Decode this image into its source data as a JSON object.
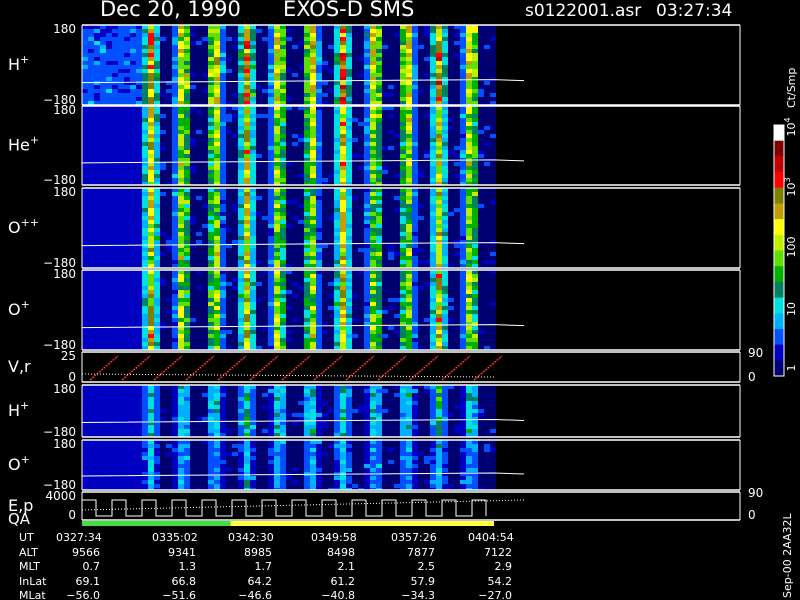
{
  "header": {
    "date": "Dec 20, 1990",
    "instrument": "EXOS-D SMS",
    "file": "s0122001.asr",
    "time": "03:27:34"
  },
  "panels": [
    {
      "label": "H",
      "sup": "+",
      "ytop": "180",
      "ybot": "−180",
      "kind": "spectrogram",
      "intensity": 1.0
    },
    {
      "label": "He",
      "sup": "+",
      "ytop": "180",
      "ybot": "−180",
      "kind": "spectrogram",
      "intensity": 0.85
    },
    {
      "label": "O",
      "sup": "++",
      "ytop": "180",
      "ybot": "−180",
      "kind": "spectrogram",
      "intensity": 0.8
    },
    {
      "label": "O",
      "sup": "+",
      "ytop": "180",
      "ybot": "−180",
      "kind": "spectrogram",
      "intensity": 0.85
    },
    {
      "label": "V,r",
      "sup": "",
      "ytop": "25",
      "ybot": "0",
      "kind": "line",
      "right_top": "90",
      "right_bot": "0"
    },
    {
      "label": "H",
      "sup": "+",
      "ytop": "180",
      "ybot": "−180",
      "kind": "spectrogram",
      "intensity": 0.45
    },
    {
      "label": "O",
      "sup": "+",
      "ytop": "180",
      "ybot": "−180",
      "kind": "spectrogram",
      "intensity": 0.3
    },
    {
      "label": "E,p",
      "sup": "",
      "label2": "QA",
      "ytop": "4000",
      "ybot": "0",
      "kind": "steps",
      "right_top": "90",
      "right_bot": "0"
    }
  ],
  "colorbar": {
    "unit": "Ct/Smp",
    "ticks": [
      "1",
      "10",
      "100",
      "10",
      "10"
    ],
    "tick_sups": [
      "",
      "",
      "",
      "3",
      "4"
    ],
    "colors": [
      "#000070",
      "#0000c0",
      "#0050ff",
      "#00b0ff",
      "#00e0e0",
      "#008060",
      "#00b000",
      "#60e000",
      "#c0f000",
      "#ffff00",
      "#c0a000",
      "#808000",
      "#ff0000",
      "#c00000",
      "#800000",
      "#ffffff"
    ]
  },
  "qa_bar": {
    "segments": [
      {
        "fraction": 0.36,
        "color": "#40e040"
      },
      {
        "fraction": 0.64,
        "color": "#ffff40"
      }
    ]
  },
  "ephemeris": {
    "row_labels": [
      "UT",
      "ALT",
      "MLT",
      "InLat",
      "MLat"
    ],
    "columns": [
      [
        "0327:34",
        "9566",
        "0.7",
        "69.1",
        "−56.0"
      ],
      [
        "0335:02",
        "9341",
        "1.3",
        "66.8",
        "−51.6"
      ],
      [
        "0342:30",
        "8985",
        "1.7",
        "64.2",
        "−46.6"
      ],
      [
        "0349:58",
        "8498",
        "2.1",
        "61.2",
        "−40.8"
      ],
      [
        "0357:26",
        "7877",
        "2.5",
        "57.9",
        "−34.3"
      ],
      [
        "0404:54",
        "7122",
        "2.9",
        "54.2",
        "−27.0"
      ]
    ]
  },
  "footer_note": "Sep-00 2AA32L",
  "chart_data": {
    "type": "heatmap",
    "title": "Dec 20, 1990   EXOS-D SMS",
    "xlabel": "UT",
    "x_ticks": [
      "0327:34",
      "0335:02",
      "0342:30",
      "0349:58",
      "0357:26",
      "0404:54"
    ],
    "panels": [
      "H+",
      "He+",
      "O++",
      "O+",
      "V,r",
      "H+",
      "O+",
      "E,p QA"
    ],
    "color_scale": {
      "type": "log",
      "range": [
        1,
        10000
      ],
      "unit": "Ct/Smp"
    }
  }
}
